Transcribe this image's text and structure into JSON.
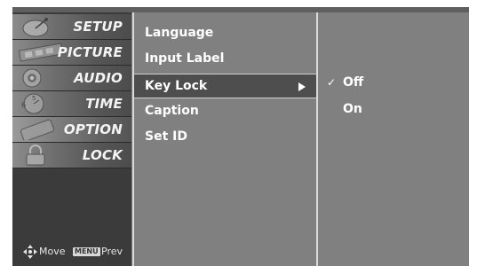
{
  "categories": [
    {
      "label": "SETUP",
      "icon": "satellite-dish-icon"
    },
    {
      "label": "PICTURE",
      "icon": "film-strip-icon"
    },
    {
      "label": "AUDIO",
      "icon": "speaker-icon"
    },
    {
      "label": "TIME",
      "icon": "clock-icon"
    },
    {
      "label": "OPTION",
      "icon": "option-tag-icon"
    },
    {
      "label": "LOCK",
      "icon": "padlock-icon"
    }
  ],
  "nav_help": {
    "move_label": "Move",
    "menu_key": "MENU",
    "prev_label": "Prev"
  },
  "menu_items": [
    {
      "label": "Language"
    },
    {
      "label": "Input Label"
    },
    {
      "label": "Key Lock"
    },
    {
      "label": "Caption"
    },
    {
      "label": "Set ID"
    }
  ],
  "selected_item": "Key Lock",
  "options": [
    {
      "label": "Off",
      "checked": true,
      "check_mark": "✓"
    },
    {
      "label": "On",
      "checked": false,
      "check_mark": ""
    }
  ],
  "colors": {
    "panel": "#808080",
    "highlight": "#4e4e4e",
    "text": "#ffffff"
  }
}
